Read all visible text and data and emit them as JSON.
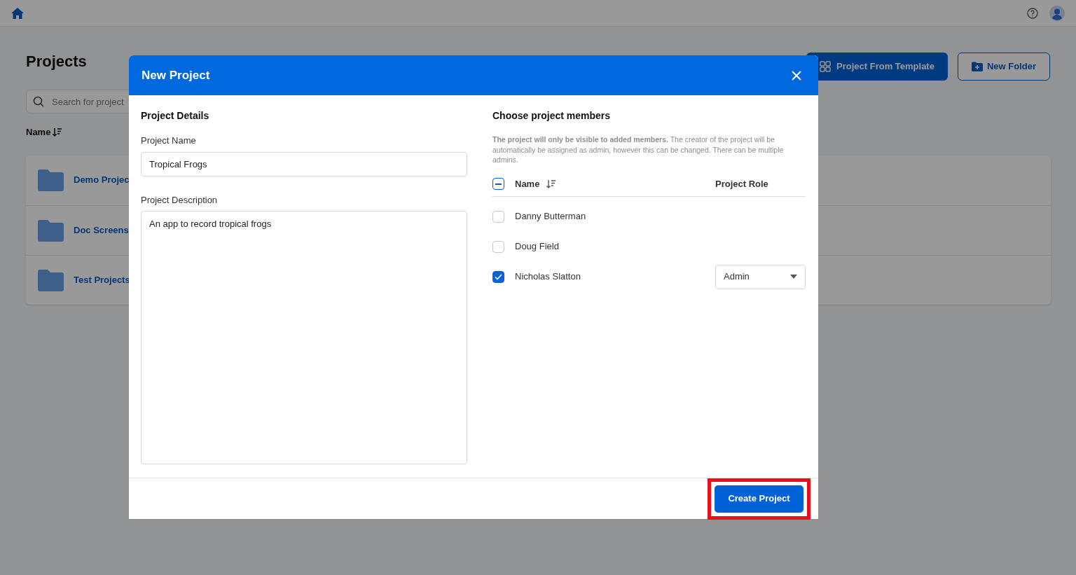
{
  "page": {
    "title": "Projects",
    "search": {
      "placeholder": "Search for project"
    },
    "sort_label": "Name",
    "header_buttons": [
      {
        "label": "Project From Template",
        "kind": "template"
      },
      {
        "label": "New Folder",
        "kind": "folder"
      }
    ],
    "folders": [
      {
        "name": "Demo Projec"
      },
      {
        "name": "Doc Screens"
      },
      {
        "name": "Test Projects"
      }
    ]
  },
  "dialog": {
    "title": "New Project",
    "details": {
      "heading": "Project Details",
      "name_label": "Project Name",
      "name_value": "Tropical Frogs",
      "description_label": "Project Description",
      "description_value": "An app to record tropical frogs"
    },
    "members": {
      "heading": "Choose project members",
      "note": "**The project will only be visible to added members.** The creator of the project will be automatically be assigned as admin, however this can be changed. There can be multiple admins.",
      "select_all_indeterminate": true,
      "columns": [
        "Name",
        "Project Role"
      ],
      "rows": [
        {
          "name": "Danny Butterman",
          "checked": false
        },
        {
          "name": "Doug Field",
          "checked": false
        },
        {
          "name": "Nicholas Slatton",
          "checked": true,
          "role": "Admin"
        }
      ]
    },
    "submit": "Create Project",
    "submit_highlighted": true
  }
}
